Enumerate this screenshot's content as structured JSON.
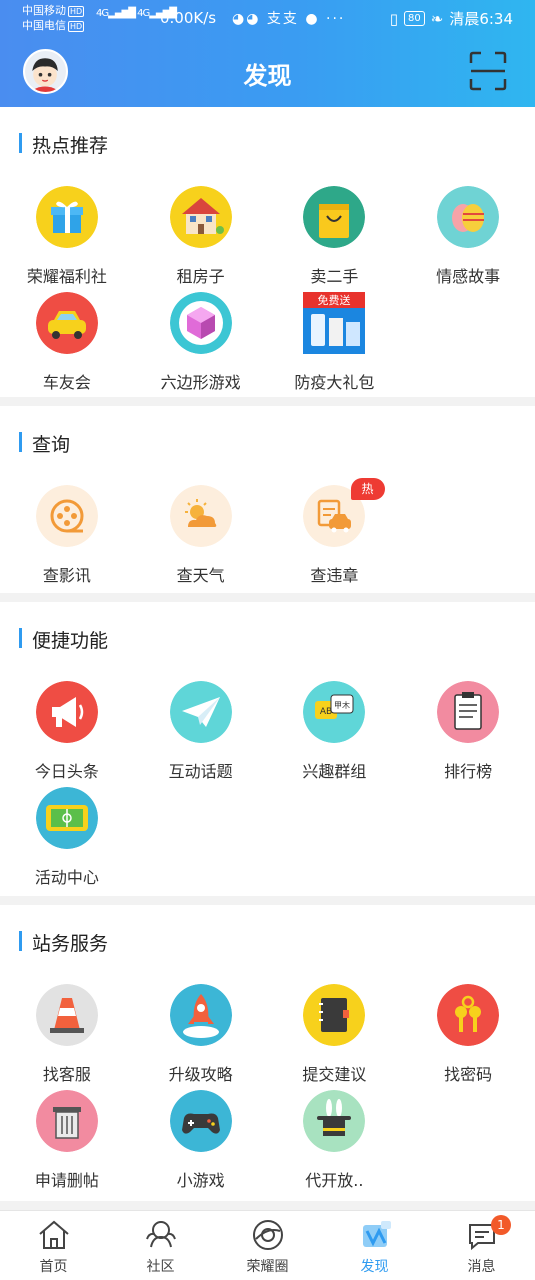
{
  "status_bar": {
    "carrier1": "中国移动",
    "carrier2": "中国电信",
    "hd": "HD",
    "network": "4G",
    "speed": "0.00K/s",
    "battery": "80",
    "time": "清晨6:34"
  },
  "header": {
    "title": "发现"
  },
  "sections": [
    {
      "title": "热点推荐",
      "items": [
        {
          "label": "荣耀福利社",
          "icon": "gift-icon"
        },
        {
          "label": "租房子",
          "icon": "house-icon"
        },
        {
          "label": "卖二手",
          "icon": "shopping-bag-icon"
        },
        {
          "label": "情感故事",
          "icon": "easter-egg-icon"
        },
        {
          "label": "车友会",
          "icon": "car-icon"
        },
        {
          "label": "六边形游戏",
          "icon": "cube-icon"
        },
        {
          "label": "防疫大礼包",
          "icon": "promo-image-icon",
          "promo_text": "免费送"
        }
      ]
    },
    {
      "title": "查询",
      "items": [
        {
          "label": "查影讯",
          "icon": "film-reel-icon"
        },
        {
          "label": "查天气",
          "icon": "weather-icon"
        },
        {
          "label": "查违章",
          "icon": "traffic-violation-icon",
          "badge": "热"
        }
      ]
    },
    {
      "title": "便捷功能",
      "items": [
        {
          "label": "今日头条",
          "icon": "megaphone-icon"
        },
        {
          "label": "互动话题",
          "icon": "paper-plane-icon"
        },
        {
          "label": "兴趣群组",
          "icon": "chat-bubbles-icon",
          "bubble1": "AB",
          "bubble2": "甲木"
        },
        {
          "label": "排行榜",
          "icon": "clipboard-icon"
        },
        {
          "label": "活动中心",
          "icon": "stadium-icon"
        }
      ]
    },
    {
      "title": "站务服务",
      "items": [
        {
          "label": "找客服",
          "icon": "traffic-cone-icon"
        },
        {
          "label": "升级攻略",
          "icon": "rocket-icon"
        },
        {
          "label": "提交建议",
          "icon": "notebook-icon"
        },
        {
          "label": "找密码",
          "icon": "keys-icon"
        },
        {
          "label": "申请删帖",
          "icon": "trash-can-icon"
        },
        {
          "label": "小游戏",
          "icon": "gamepad-icon"
        },
        {
          "label": "代开放..",
          "icon": "magic-hat-icon"
        }
      ]
    }
  ],
  "tabbar": [
    {
      "label": "首页",
      "icon": "home-icon"
    },
    {
      "label": "社区",
      "icon": "community-icon"
    },
    {
      "label": "荣耀圈",
      "icon": "circle-icon"
    },
    {
      "label": "发现",
      "icon": "discover-icon",
      "active": true
    },
    {
      "label": "消息",
      "icon": "message-icon",
      "badge": "1"
    }
  ],
  "colors": {
    "accent": "#2f9bf0",
    "header_gradient_start": "#4a8df0",
    "header_gradient_end": "#2fb6f0",
    "hot_badge": "#ee3b33"
  }
}
